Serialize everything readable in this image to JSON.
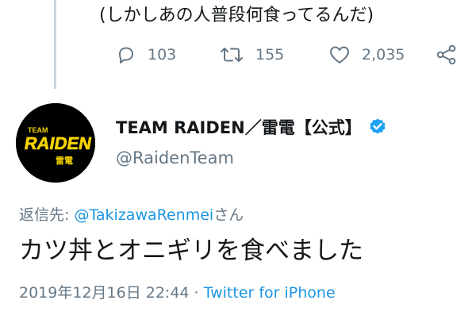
{
  "previous_tweet": {
    "text": "(しかしあの人普段何食ってるんだ)",
    "actions": {
      "reply_count": "103",
      "retweet_count": "155",
      "like_count": "2,035"
    }
  },
  "tweet": {
    "avatar": {
      "logo_top": "TEAM",
      "logo_main": "RAIDEN",
      "logo_kanji": "雷電"
    },
    "display_name": "TEAM RAIDEN／雷電【公式】",
    "handle": "@RaidenTeam",
    "reply_prefix": "返信先: ",
    "reply_mention": "@TakizawaRenmei",
    "reply_suffix": "さん",
    "text": "カツ丼とオニギリを食べました",
    "timestamp": "2019年12月16日 22:44",
    "separator": " · ",
    "source": "Twitter for iPhone"
  },
  "colors": {
    "text": "#14171a",
    "secondary": "#657786",
    "link": "#1b95e0",
    "verified": "#1da1f2",
    "logo_yellow": "#f5d300",
    "thread_line": "#ccd6dd"
  }
}
